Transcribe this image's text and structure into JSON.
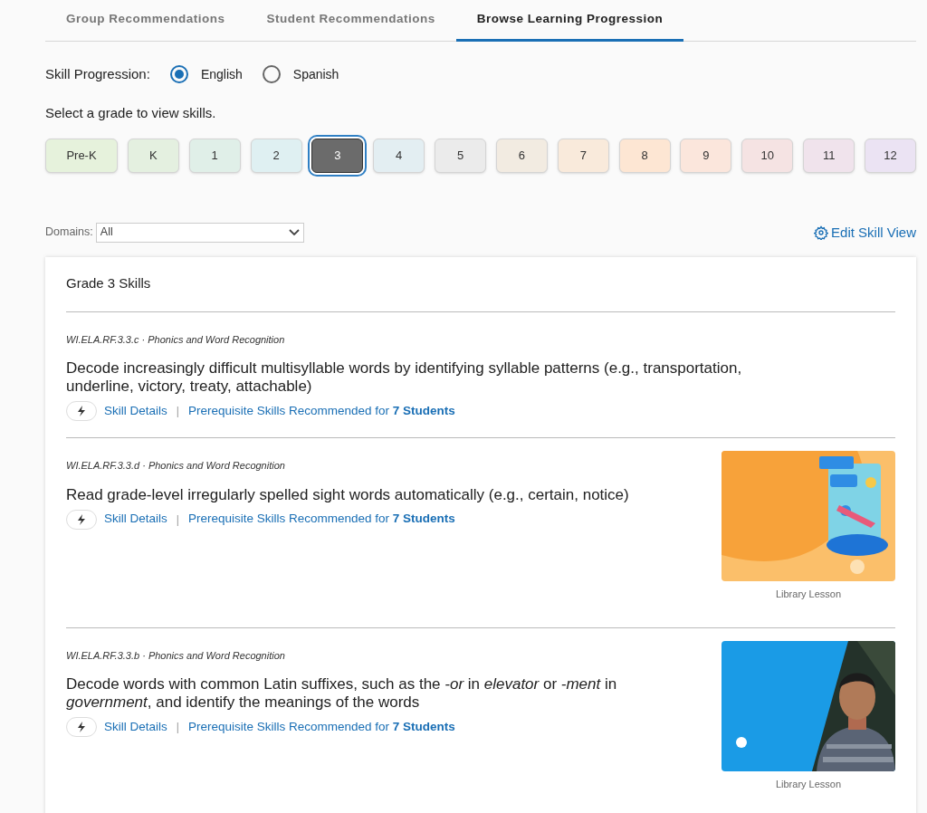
{
  "tabs": [
    {
      "label": "Group Recommendations",
      "selected": false
    },
    {
      "label": "Student Recommendations",
      "selected": false
    },
    {
      "label": "Browse Learning Progression",
      "selected": true
    }
  ],
  "skill_progression": {
    "label": "Skill Progression:",
    "options": [
      {
        "label": "English",
        "selected": true
      },
      {
        "label": "Spanish",
        "selected": false
      }
    ]
  },
  "grade_prompt": "Select a grade to view skills.",
  "grades": [
    {
      "label": "Pre-K",
      "color": "#e6f2dc",
      "selected": false
    },
    {
      "label": "K",
      "color": "#e4f0e0",
      "selected": false
    },
    {
      "label": "1",
      "color": "#e0efe8",
      "selected": false
    },
    {
      "label": "2",
      "color": "#dff0f2",
      "selected": false
    },
    {
      "label": "3",
      "color": "#6b6b6b",
      "selected": true
    },
    {
      "label": "4",
      "color": "#e3eef2",
      "selected": false
    },
    {
      "label": "5",
      "color": "#ebebeb",
      "selected": false
    },
    {
      "label": "6",
      "color": "#f2ebe1",
      "selected": false
    },
    {
      "label": "7",
      "color": "#f9eadb",
      "selected": false
    },
    {
      "label": "8",
      "color": "#fde6d3",
      "selected": false
    },
    {
      "label": "9",
      "color": "#fbe6dc",
      "selected": false
    },
    {
      "label": "10",
      "color": "#f5e3e3",
      "selected": false
    },
    {
      "label": "11",
      "color": "#f0e3ec",
      "selected": false
    },
    {
      "label": "12",
      "color": "#ebe3f3",
      "selected": false
    }
  ],
  "domains": {
    "label": "Domains:",
    "value": "All"
  },
  "edit_skill_view": "Edit Skill View",
  "skills_title": "Grade 3 Skills",
  "skills": [
    {
      "code": "WI.ELA.RF.3.3.c · Phonics and Word Recognition",
      "description": "Decode increasingly difficult multisyllable words by identifying syllable patterns (e.g., transportation, underline, victory, treaty, attachable)",
      "details_link": "Skill Details",
      "separator": "|",
      "prereq_link": "Prerequisite Skills Recommended for **7 Students**"
    },
    {
      "code": "WI.ELA.RF.3.3.d · Phonics and Word Recognition",
      "description": "Read grade-level irregularly spelled sight words automatically (e.g., certain, notice)",
      "details_link": "Skill Details",
      "separator": "|",
      "prereq_link": "Prerequisite Skills Recommended for **7 Students**",
      "lesson": {
        "kind": "picture",
        "caption": "Library Lesson"
      }
    },
    {
      "code": "WI.ELA.RF.3.3.b · Phonics and Word Recognition",
      "description": "Decode words with common Latin suffixes, such as the *-or* in *elevator* or *-ment* in *government*, and identify the meanings of the words",
      "details_link": "Skill Details",
      "separator": "|",
      "prereq_link": "Prerequisite Skills Recommended for **7 Students**",
      "lesson": {
        "kind": "picture",
        "caption": "Library Lesson"
      }
    }
  ]
}
